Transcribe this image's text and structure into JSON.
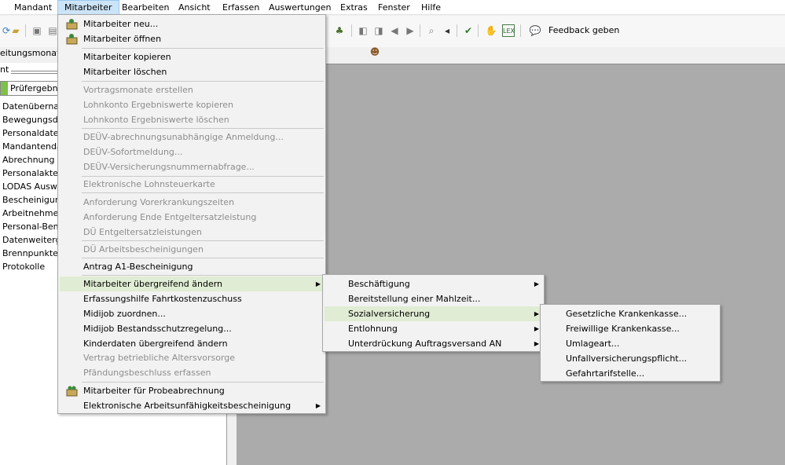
{
  "menubar": {
    "items": [
      "Mandant",
      "Mitarbeiter",
      "Bearbeiten",
      "Ansicht",
      "Erfassen",
      "Auswertungen",
      "Extras",
      "Fenster",
      "Hilfe"
    ]
  },
  "toolbar": {
    "feedback_label": "Feedback geben"
  },
  "left": {
    "sub_title": "eitungsmonat",
    "tab_label": "nt",
    "pruef_tab": "Prüfergebni",
    "nav": [
      "Datenübernah",
      "Bewegungsda",
      "Personaldaten",
      "Mandantenda",
      "Abrechnung",
      "Personalakte",
      "LODAS Auswe",
      "Bescheinigung",
      "Arbeitnehmer",
      "Personal-Benc",
      "Datenweiterga",
      "Brennpunkte",
      "Protokolle"
    ]
  },
  "menu_mitarbeiter": {
    "items": [
      {
        "label": "Mitarbeiter neu...",
        "disabled": false
      },
      {
        "label": "Mitarbeiter öffnen",
        "disabled": false
      },
      {
        "label": "Mitarbeiter kopieren",
        "disabled": false
      },
      {
        "label": "Mitarbeiter löschen",
        "disabled": false
      },
      {
        "label": "Vortragsmonate erstellen",
        "disabled": true
      },
      {
        "label": "Lohnkonto Ergebniswerte kopieren",
        "disabled": true
      },
      {
        "label": "Lohnkonto Ergebniswerte löschen",
        "disabled": true
      },
      {
        "label": "DEÜV-abrechnungsunabhängige Anmeldung...",
        "disabled": true
      },
      {
        "label": "DEÜV-Sofortmeldung...",
        "disabled": true
      },
      {
        "label": "DEÜV-Versicherungsnummernabfrage...",
        "disabled": true
      },
      {
        "label": "Elektronische Lohnsteuerkarte",
        "disabled": true
      },
      {
        "label": "Anforderung Vorerkrankungszeiten",
        "disabled": true
      },
      {
        "label": "Anforderung Ende Entgeltersatzleistung",
        "disabled": true
      },
      {
        "label": "DÜ Entgeltersatzleistungen",
        "disabled": true
      },
      {
        "label": "DÜ Arbeitsbescheinigungen",
        "disabled": true
      },
      {
        "label": "Antrag A1-Bescheinigung",
        "disabled": false
      },
      {
        "label": "Mitarbeiter übergreifend ändern",
        "disabled": false
      },
      {
        "label": "Erfassungshilfe Fahrtkostenzuschuss",
        "disabled": false
      },
      {
        "label": "Midijob zuordnen...",
        "disabled": false
      },
      {
        "label": "Midijob Bestandsschutzregelung...",
        "disabled": false
      },
      {
        "label": "Kinderdaten übergreifend ändern",
        "disabled": false
      },
      {
        "label": "Vertrag betriebliche Altersvorsorge",
        "disabled": true
      },
      {
        "label": "Pfändungsbeschluss erfassen",
        "disabled": true
      },
      {
        "label": "Mitarbeiter für Probeabrechnung",
        "disabled": false
      },
      {
        "label": "Elektronische Arbeitsunfähigkeitsbescheinigung",
        "disabled": false
      }
    ]
  },
  "menu_uebergreifend": {
    "items": [
      "Beschäftigung",
      "Bereitstellung einer Mahlzeit...",
      "Sozialversicherung",
      "Entlohnung",
      "Unterdrückung Auftragsversand AN"
    ]
  },
  "menu_sv": {
    "items": [
      "Gesetzliche Krankenkasse...",
      "Freiwillige Krankenkasse...",
      "Umlageart...",
      "Unfallversicherungspflicht...",
      "Gefahrtarifstelle..."
    ]
  },
  "colors": {
    "highlight": "#e0ecd3",
    "menubar_active": "#cce4f7",
    "workarea": "#ababab",
    "disabled_text": "#8d8d8d"
  }
}
